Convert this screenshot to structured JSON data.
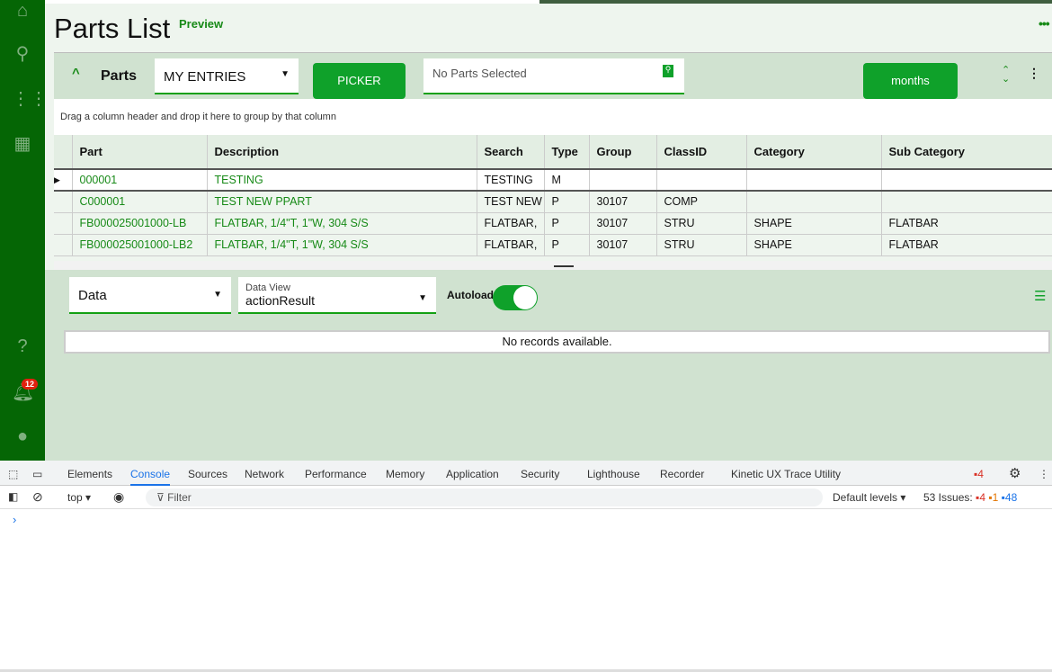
{
  "sidebar": {
    "notification_count": "12"
  },
  "header": {
    "title": "Parts List",
    "badge": "Preview"
  },
  "panel": {
    "title": "Parts",
    "filter": "MY ENTRIES",
    "picker_label": "PICKER",
    "selection_placeholder": "No Parts Selected",
    "months_label": "months"
  },
  "grid": {
    "group_hint": "Drag a column header and drop it here to group by that column",
    "columns": [
      "Part",
      "Description",
      "Search",
      "Type",
      "Group",
      "ClassID",
      "Category",
      "Sub Category"
    ],
    "rows": [
      [
        "000001",
        "TESTING",
        "TESTING",
        "M",
        "",
        "",
        "",
        ""
      ],
      [
        "C000001",
        "TEST NEW PPART",
        "TEST NEW",
        "P",
        "30107",
        "COMP",
        "",
        ""
      ],
      [
        "FB000025001000-LB",
        "FLATBAR, 1/4\"T, 1\"W, 304 S/S",
        "FLATBAR,",
        "P",
        "30107",
        "STRU",
        "SHAPE",
        "FLATBAR"
      ],
      [
        "FB000025001000-LB2",
        "FLATBAR, 1/4\"T, 1\"W, 304 S/S",
        "FLATBAR,",
        "P",
        "30107",
        "STRU",
        "SHAPE",
        "FLATBAR"
      ]
    ]
  },
  "lower": {
    "data_select": "Data",
    "dataview_label": "Data View",
    "dataview_value": "actionResult",
    "autoload_label": "Autoload",
    "autoload_on": true,
    "empty": "No records available."
  },
  "devtools": {
    "tabs": [
      "Elements",
      "Console",
      "Sources",
      "Network",
      "Performance",
      "Memory",
      "Application",
      "Security",
      "Lighthouse",
      "Recorder",
      "Kinetic UX Trace Utility"
    ],
    "active_tab": "Console",
    "error_count": "4",
    "context": "top",
    "filter_placeholder": "Filter",
    "levels": "Default levels",
    "issues_label": "53 Issues:",
    "issues_errors": "4",
    "issues_warnings": "1",
    "issues_info": "48",
    "prompt": "›"
  },
  "colors": {
    "brand": "#056605",
    "accent": "#0fa12a"
  }
}
